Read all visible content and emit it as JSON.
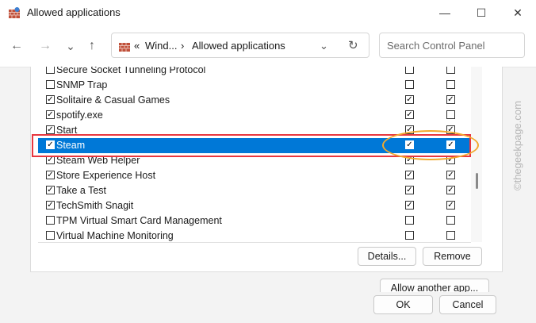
{
  "window": {
    "title": "Allowed applications",
    "minimize_glyph": "—",
    "maximize_glyph": "☐",
    "close_glyph": "✕"
  },
  "nav": {
    "back_glyph": "←",
    "forward_glyph": "→",
    "recent_glyph": "⌄",
    "up_glyph": "↑",
    "breadcrumb": [
      "Wind...",
      "Allowed applications"
    ],
    "crumb_overflow": "«",
    "crumb_sep": "›",
    "address_dropdown_glyph": "⌄",
    "refresh_glyph": "↻",
    "search_placeholder": "Search Control Panel"
  },
  "apps": [
    {
      "name": "Secure Socket Tunneling Protocol",
      "enabled": false,
      "private": false,
      "public": false
    },
    {
      "name": "SNMP Trap",
      "enabled": false,
      "private": false,
      "public": false
    },
    {
      "name": "Solitaire & Casual Games",
      "enabled": true,
      "private": true,
      "public": true
    },
    {
      "name": "spotify.exe",
      "enabled": true,
      "private": true,
      "public": false
    },
    {
      "name": "Start",
      "enabled": true,
      "private": true,
      "public": true
    },
    {
      "name": "Steam",
      "enabled": true,
      "private": true,
      "public": true,
      "selected": true
    },
    {
      "name": "Steam Web Helper",
      "enabled": true,
      "private": true,
      "public": true
    },
    {
      "name": "Store Experience Host",
      "enabled": true,
      "private": true,
      "public": true
    },
    {
      "name": "Take a Test",
      "enabled": true,
      "private": true,
      "public": true
    },
    {
      "name": "TechSmith Snagit",
      "enabled": true,
      "private": true,
      "public": true
    },
    {
      "name": "TPM Virtual Smart Card Management",
      "enabled": false,
      "private": false,
      "public": false
    },
    {
      "name": "Virtual Machine Monitoring",
      "enabled": false,
      "private": false,
      "public": false
    }
  ],
  "buttons": {
    "details": "Details...",
    "remove": "Remove",
    "allow_another": "Allow another app...",
    "ok": "OK",
    "cancel": "Cancel"
  },
  "watermark": "©thegeekpage.com",
  "colors": {
    "selection": "#0078d7",
    "highlight_box": "#e8373f",
    "highlight_oval": "#f2a92d"
  }
}
